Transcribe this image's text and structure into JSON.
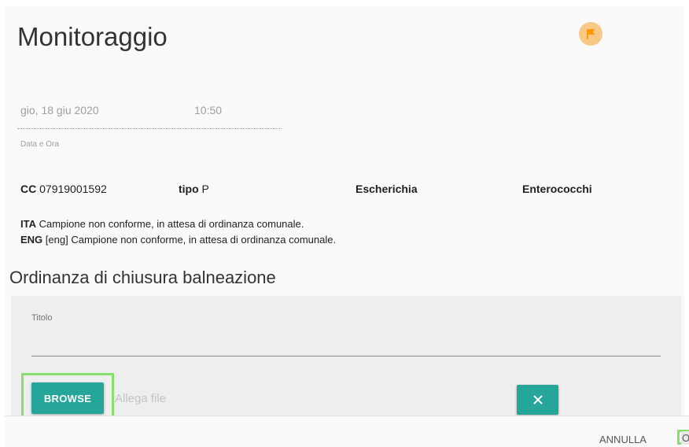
{
  "header": {
    "title": "Monitoraggio",
    "flag_icon": "flag-icon",
    "flag_color": "#ff9800"
  },
  "datetime": {
    "date": "gio, 18 giu 2020",
    "time": "10:50",
    "label": "Data e Ora"
  },
  "info": {
    "cc_label": "CC",
    "cc_value": "07919001592",
    "tipo_label": "tipo",
    "tipo_value": "P",
    "escherichia_label": "Escherichia",
    "enterococchi_label": "Enterococchi"
  },
  "messages": {
    "ita_label": "ITA",
    "ita_text": "Campione non conforme, in attesa di ordinanza comunale.",
    "eng_label": "ENG",
    "eng_text": "[eng] Campione non conforme, in attesa di ordinanza comunale."
  },
  "section": {
    "title": "Ordinanza di chiusura balneazione"
  },
  "form": {
    "titolo_label": "Titolo",
    "titolo_value": "",
    "browse_label": "BROWSE",
    "attach_placeholder": "Allega file",
    "clear_icon": "close-icon"
  },
  "footer": {
    "annulla_label": "ANNULLA",
    "next_label": "O"
  },
  "colors": {
    "accent": "#26a69a",
    "flag_bg": "#f7c886",
    "highlight": "#86e06b"
  }
}
